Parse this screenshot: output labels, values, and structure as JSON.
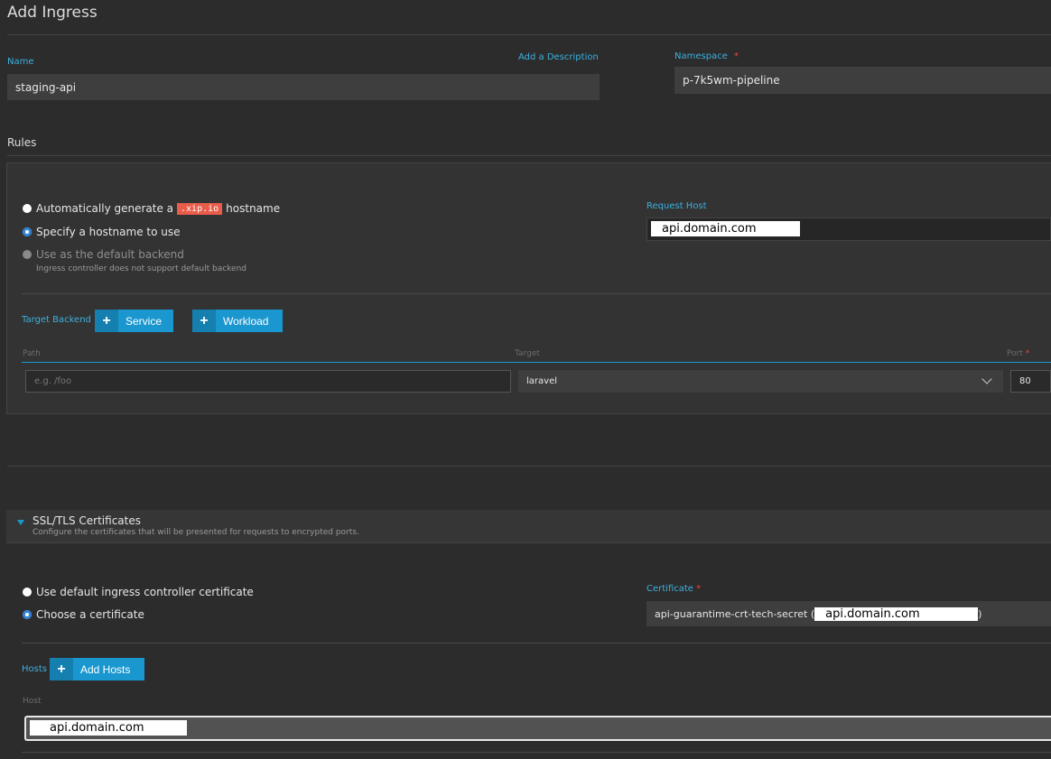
{
  "page": {
    "title": "Add Ingress"
  },
  "name": {
    "label": "Name",
    "value": "staging-api",
    "add_description": "Add a Description"
  },
  "namespace": {
    "label": "Namespace",
    "required": "*",
    "value": "p-7k5wm-pipeline"
  },
  "rules": {
    "heading": "Rules",
    "options": {
      "auto_prefix": "Automatically generate a",
      "auto_badge": ".xip.io",
      "auto_suffix": "hostname",
      "specify": "Specify a hostname to use",
      "default_backend": "Use as the default backend",
      "default_backend_note": "Ingress controller does not support default backend"
    },
    "request_host": {
      "label": "Request Host",
      "value": "api.domain.com"
    },
    "target_backend": {
      "label": "Target Backend",
      "service_button": "Service",
      "workload_button": "Workload"
    },
    "columns": {
      "path": "Path",
      "target": "Target",
      "port": "Port",
      "port_required": "*"
    },
    "row": {
      "path_placeholder": "e.g. /foo",
      "target": "laravel",
      "port": "80"
    }
  },
  "ssl": {
    "heading": "SSL/TLS Certificates",
    "description": "Configure the certificates that will be presented for requests to encrypted ports.",
    "options": {
      "default_cert": "Use default ingress controller certificate",
      "choose_cert": "Choose a certificate"
    },
    "certificate": {
      "label": "Certificate",
      "required": "*",
      "name": "api-guarantime-crt-tech-secret (",
      "domain": "api.domain.com",
      "close": ")"
    },
    "hosts": {
      "label": "Hosts",
      "add_button": "Add Hosts",
      "column": "Host",
      "value": "api.domain.com"
    }
  },
  "colors": {
    "accent": "#1a97cf",
    "required": "#e04b4b",
    "badge": "#e85d4a"
  },
  "icons": {
    "plus": "plus-icon",
    "chevron": "chevron-down-icon",
    "triangle": "caret-down-icon"
  }
}
